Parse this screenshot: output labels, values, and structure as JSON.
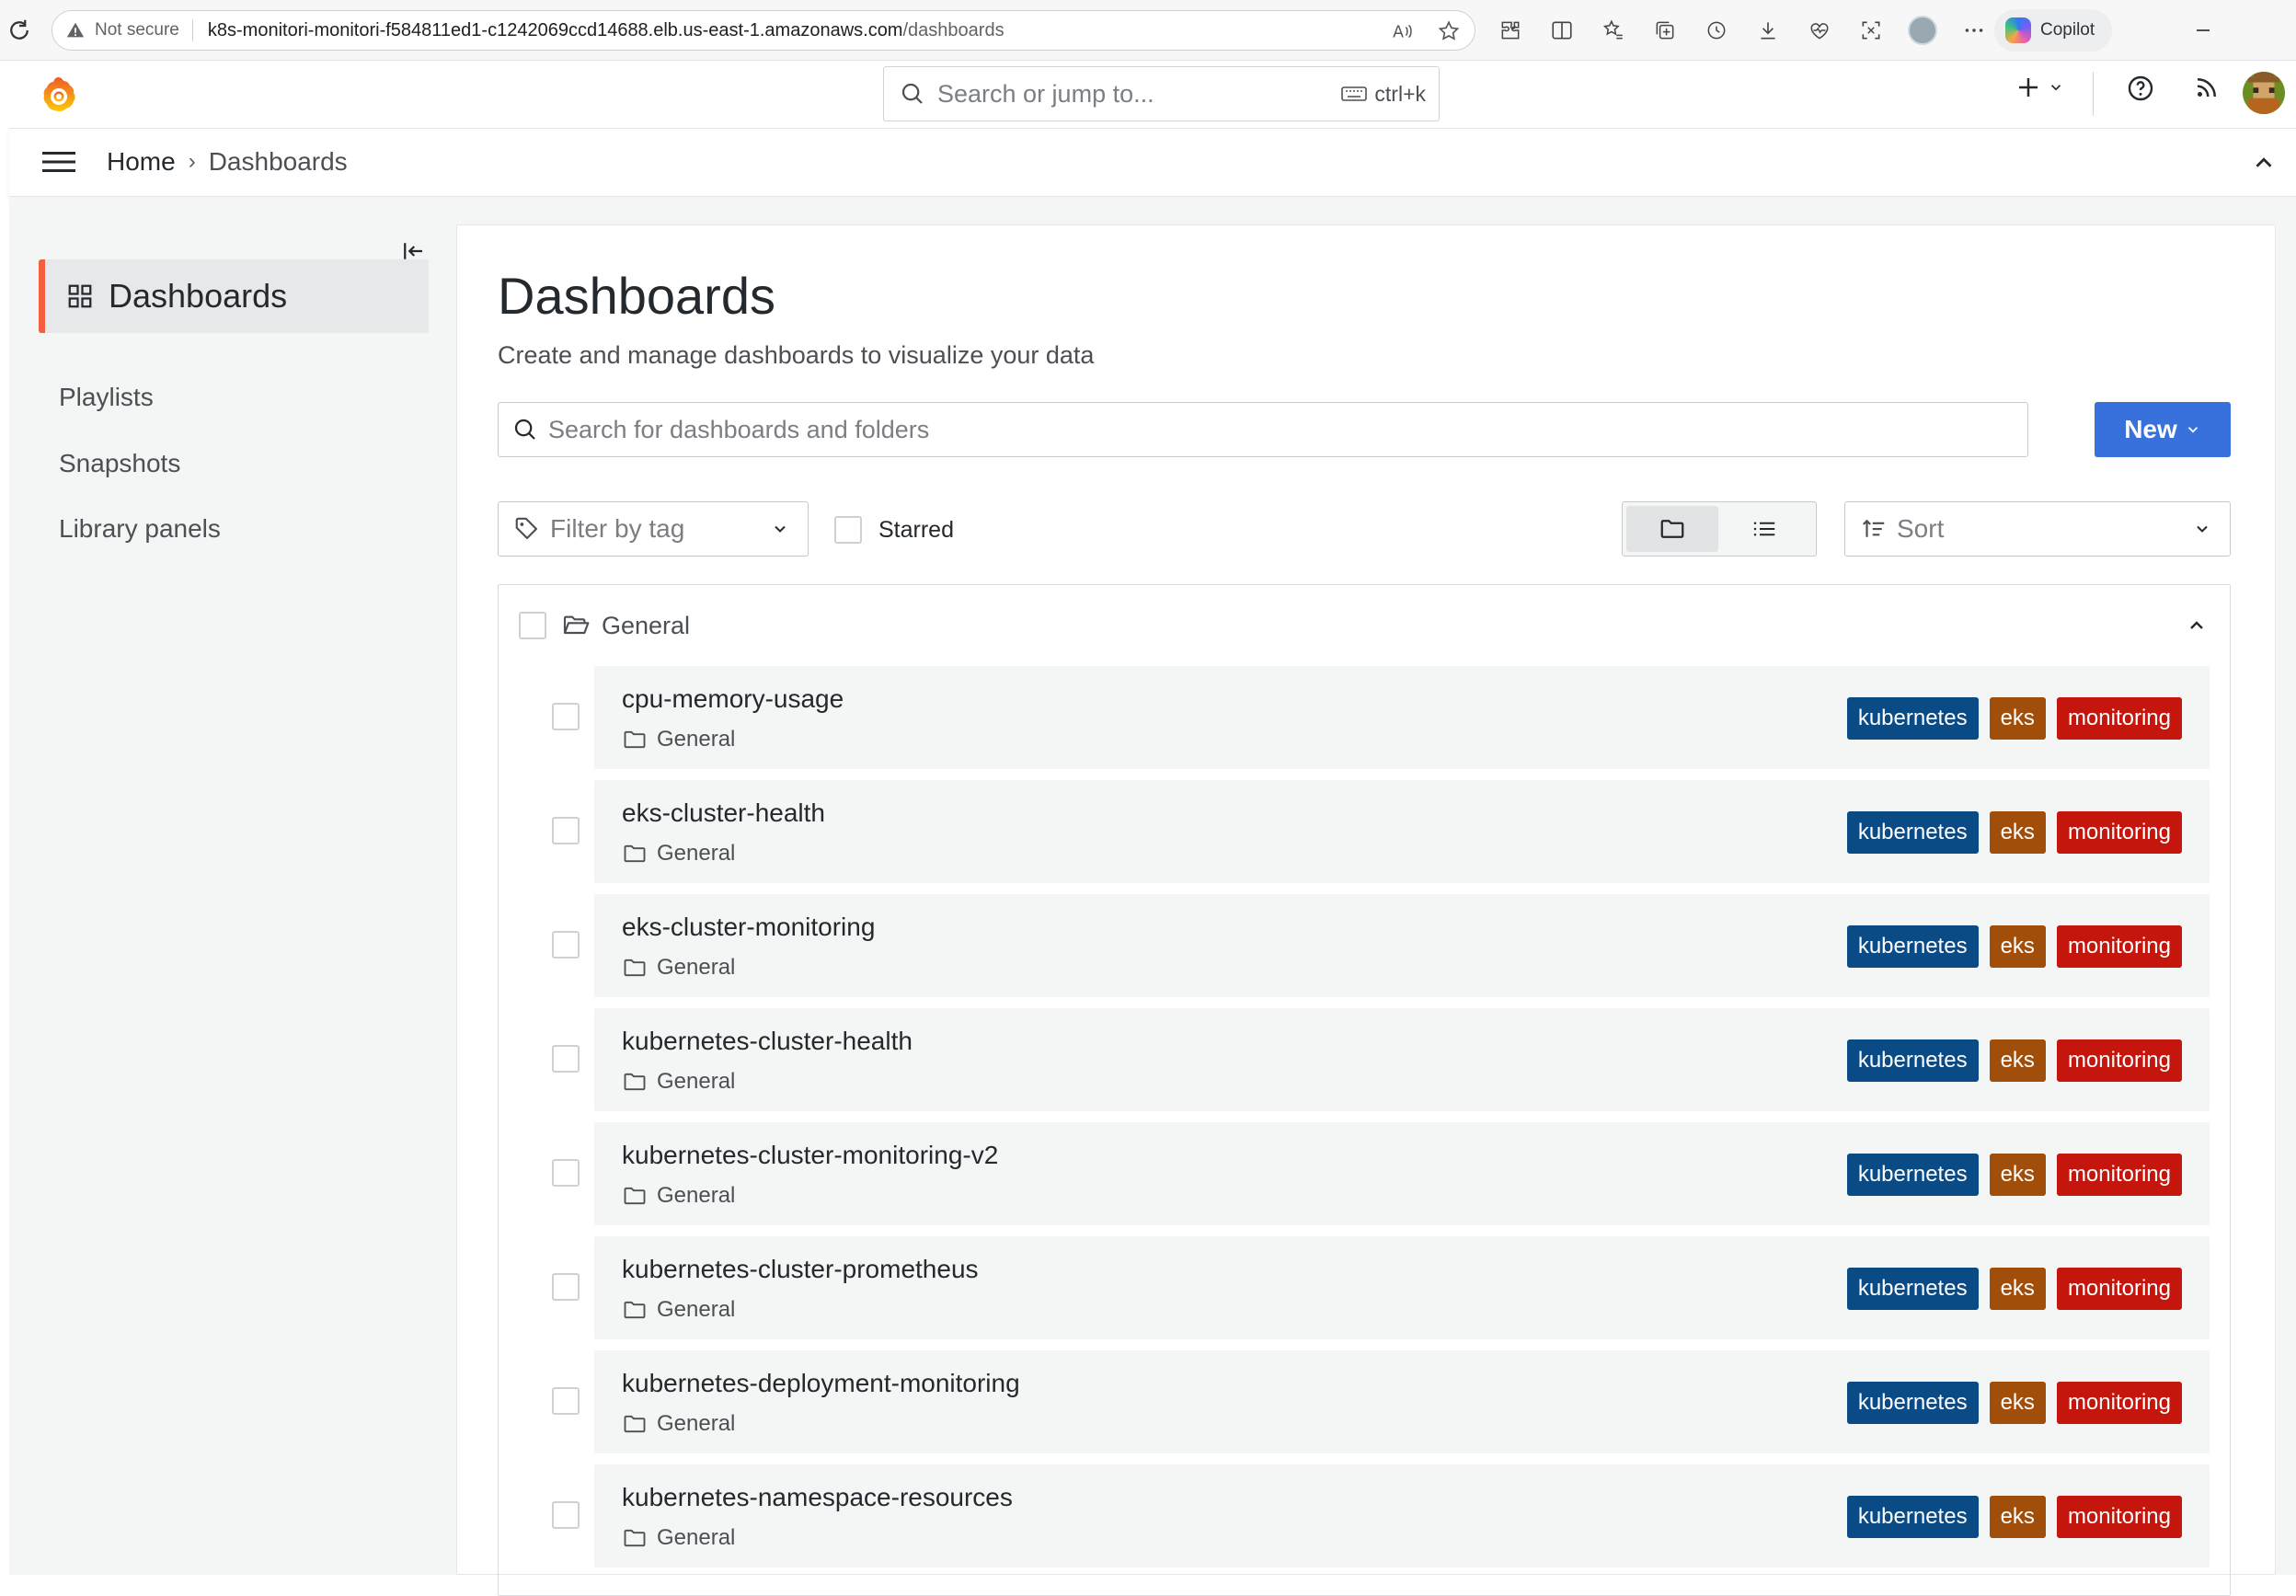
{
  "browser": {
    "security_label": "Not secure",
    "url_host": "k8s-monitori-monitori-f584811ed1-c1242069ccd14688.elb.us-east-1.amazonaws.com",
    "url_path": "/dashboards",
    "copilot_label": "Copilot"
  },
  "topnav": {
    "search_placeholder": "Search or jump to...",
    "shortcut_label": "ctrl+k"
  },
  "breadcrumb": {
    "home": "Home",
    "separator": "›",
    "current": "Dashboards"
  },
  "sidebar": {
    "active_label": "Dashboards",
    "items": [
      {
        "label": "Playlists"
      },
      {
        "label": "Snapshots"
      },
      {
        "label": "Library panels"
      }
    ]
  },
  "main": {
    "title": "Dashboards",
    "subtitle": "Create and manage dashboards to visualize your data",
    "search_placeholder": "Search for dashboards and folders",
    "new_button": "New",
    "filter_placeholder": "Filter by tag",
    "starred_label": "Starred",
    "sort_placeholder": "Sort",
    "view_mode": "folders"
  },
  "folder": {
    "name": "General",
    "expanded": true,
    "dashboards": [
      {
        "title": "cpu-memory-usage",
        "folder": "General",
        "tags": [
          "kubernetes",
          "eks",
          "monitoring"
        ]
      },
      {
        "title": "eks-cluster-health",
        "folder": "General",
        "tags": [
          "kubernetes",
          "eks",
          "monitoring"
        ]
      },
      {
        "title": "eks-cluster-monitoring",
        "folder": "General",
        "tags": [
          "kubernetes",
          "eks",
          "monitoring"
        ]
      },
      {
        "title": "kubernetes-cluster-health",
        "folder": "General",
        "tags": [
          "kubernetes",
          "eks",
          "monitoring"
        ]
      },
      {
        "title": "kubernetes-cluster-monitoring-v2",
        "folder": "General",
        "tags": [
          "kubernetes",
          "eks",
          "monitoring"
        ]
      },
      {
        "title": "kubernetes-cluster-prometheus",
        "folder": "General",
        "tags": [
          "kubernetes",
          "eks",
          "monitoring"
        ]
      },
      {
        "title": "kubernetes-deployment-monitoring",
        "folder": "General",
        "tags": [
          "kubernetes",
          "eks",
          "monitoring"
        ]
      },
      {
        "title": "kubernetes-namespace-resources",
        "folder": "General",
        "tags": [
          "kubernetes",
          "eks",
          "monitoring"
        ]
      }
    ]
  },
  "colors": {
    "accent": "#f55f3e",
    "primary_button": "#3871dc",
    "tag_kubernetes": "#0a4a85",
    "tag_eks": "#a14e0b",
    "tag_monitoring": "#c4160c"
  },
  "icons": {
    "browser": [
      "reload-icon",
      "warning-icon",
      "read-aloud-icon",
      "favorite-star-icon",
      "extensions-icon",
      "split-screen-icon",
      "favorites-icon",
      "collections-icon",
      "history-icon",
      "downloads-icon",
      "performance-icon",
      "screenshot-icon",
      "more-icon",
      "minimize-icon"
    ],
    "grafana": [
      "grafana-logo-icon",
      "search-icon",
      "keyboard-icon",
      "plus-icon",
      "help-icon",
      "news-icon",
      "menu-icon",
      "chevron-up-icon",
      "dock-menu-icon",
      "dashboard-grid-icon",
      "tag-icon",
      "folder-view-icon",
      "list-view-icon",
      "sort-icon",
      "folder-open-icon",
      "folder-icon"
    ]
  }
}
